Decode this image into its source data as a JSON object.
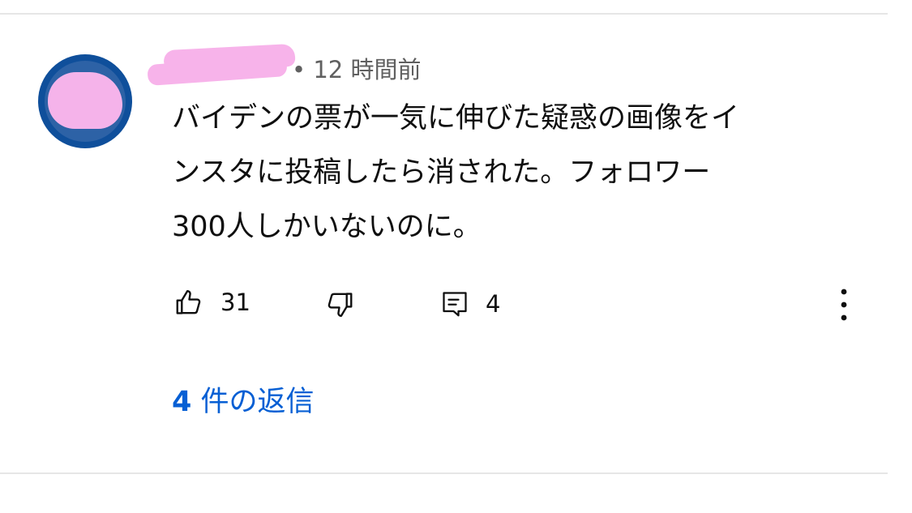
{
  "comment": {
    "timestamp": "• 12 時間前",
    "text_lines": [
      "バイデンの票が一気に伸びた疑惑の画像をイ",
      "ンスタに投稿したら消された。フォロワー",
      "300人しかいないのに。"
    ],
    "like_count": "31",
    "reply_count": "4",
    "replies_link": {
      "count": "4",
      "label": " 件の返信"
    }
  },
  "icons": {
    "like": "thumbs-up-icon",
    "dislike": "thumbs-down-icon",
    "reply": "comment-icon",
    "more": "more-vert-icon"
  },
  "colors": {
    "link": "#065fd4",
    "secondary_text": "#606060",
    "primary_text": "#0f0f0f",
    "divider": "#e6e6e6",
    "avatar_bg": "#0f4f9b",
    "redaction": "#f7b3ea"
  }
}
